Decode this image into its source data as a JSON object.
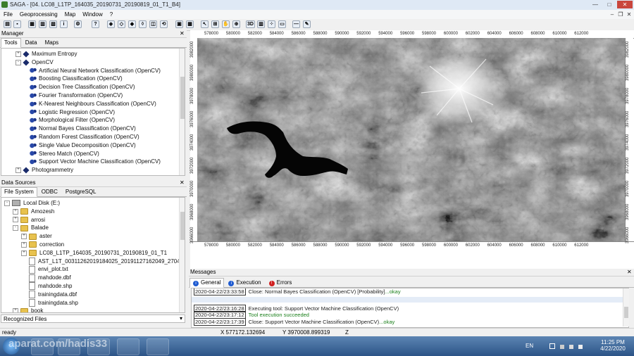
{
  "window": {
    "title": "SAGA - [04. LC08_L1TP_164035_20190731_20190819_01_T1_B4]"
  },
  "menu": [
    "File",
    "Geoprocessing",
    "Map",
    "Window",
    "?"
  ],
  "manager": {
    "title": "Manager",
    "tabs": [
      "Tools",
      "Data",
      "Maps"
    ],
    "tree": [
      {
        "label": "Maximum Entropy",
        "level": 1,
        "kind": "library",
        "exp": "+"
      },
      {
        "label": "OpenCV",
        "level": 1,
        "kind": "library",
        "exp": "-"
      },
      {
        "label": "Artificial Neural Network Classification (OpenCV)",
        "level": 2,
        "kind": "tool"
      },
      {
        "label": "Boosting Classification (OpenCV)",
        "level": 2,
        "kind": "tool"
      },
      {
        "label": "Decision Tree Classification (OpenCV)",
        "level": 2,
        "kind": "tool"
      },
      {
        "label": "Fourier Transformation (OpenCV)",
        "level": 2,
        "kind": "tool"
      },
      {
        "label": "K-Nearest Neighbours Classification (OpenCV)",
        "level": 2,
        "kind": "tool"
      },
      {
        "label": "Logistic Regression (OpenCV)",
        "level": 2,
        "kind": "tool"
      },
      {
        "label": "Morphological Filter (OpenCV)",
        "level": 2,
        "kind": "tool"
      },
      {
        "label": "Normal Bayes Classification (OpenCV)",
        "level": 2,
        "kind": "tool"
      },
      {
        "label": "Random Forest Classification (OpenCV)",
        "level": 2,
        "kind": "tool"
      },
      {
        "label": "Single Value Decomposition (OpenCV)",
        "level": 2,
        "kind": "tool"
      },
      {
        "label": "Stereo Match (OpenCV)",
        "level": 2,
        "kind": "tool"
      },
      {
        "label": "Support Vector Machine Classification (OpenCV)",
        "level": 2,
        "kind": "tool"
      },
      {
        "label": "Photogrammetry",
        "level": 1,
        "kind": "library",
        "exp": "+"
      }
    ]
  },
  "datasources": {
    "title": "Data Sources",
    "tabs": [
      "File System",
      "ODBC",
      "PostgreSQL"
    ],
    "tree": [
      {
        "label": "Local Disk (E:)",
        "level": 0,
        "kind": "disk",
        "exp": "-"
      },
      {
        "label": "Amozesh",
        "level": 1,
        "kind": "folder",
        "exp": "+"
      },
      {
        "label": "arrosi",
        "level": 1,
        "kind": "folder",
        "exp": "+"
      },
      {
        "label": "Balade",
        "level": 1,
        "kind": "folder",
        "exp": "-"
      },
      {
        "label": "aster",
        "level": 2,
        "kind": "folder",
        "exp": "+"
      },
      {
        "label": "correction",
        "level": 2,
        "kind": "folder",
        "exp": "+"
      },
      {
        "label": "LC08_L1TP_164035_20190731_20190819_01_T1",
        "level": 2,
        "kind": "folder",
        "exp": "+"
      },
      {
        "label": "AST_L1T_00311262019184025_20191127162049_27047.hdf",
        "level": 2,
        "kind": "file"
      },
      {
        "label": "envi_plot.txt",
        "level": 2,
        "kind": "file"
      },
      {
        "label": "mahdode.dbf",
        "level": 2,
        "kind": "file"
      },
      {
        "label": "mahdode.shp",
        "level": 2,
        "kind": "file"
      },
      {
        "label": "trainingdata.dbf",
        "level": 2,
        "kind": "file"
      },
      {
        "label": "trainingdata.shp",
        "level": 2,
        "kind": "file"
      },
      {
        "label": "book",
        "level": 1,
        "kind": "folder",
        "exp": "+"
      }
    ],
    "recognized": "Recognized Files"
  },
  "map": {
    "xticks": [
      "578000",
      "580000",
      "582000",
      "584000",
      "586000",
      "588000",
      "590000",
      "592000",
      "594000",
      "596000",
      "598000",
      "600000",
      "602000",
      "604000",
      "606000",
      "608000",
      "610000",
      "612000"
    ],
    "yticks": [
      "3982000",
      "3980000",
      "3978000",
      "3976000",
      "3974000",
      "3972000",
      "3970000",
      "3968000",
      "3966000"
    ]
  },
  "messages": {
    "title": "Messages",
    "tabs": [
      "General",
      "Execution",
      "Errors"
    ],
    "lines": [
      {
        "ts": "2020-04-22/23:33:58",
        "text": "Close: Normal Bayes Classification (OpenCV) [Probability]",
        "ok": "...okay"
      },
      {
        "ts": "2020-04-22/23:16:28",
        "text": "Executing tool: Support Vector Machine Classification (OpenCV)",
        "ok": ""
      },
      {
        "ts": "2020-04-22/23:17:12",
        "text": "Tool execution succeeded",
        "ok": ""
      },
      {
        "ts": "2020-04-22/23:17:39",
        "text": "Close: Support Vector Machine Classification (OpenCV)",
        "ok": "...okay"
      }
    ]
  },
  "status": {
    "ready": "ready",
    "x": "X 577172.132694",
    "y": "Y 3970008.899319",
    "z": "Z"
  },
  "taskbar": {
    "lang": "EN",
    "time": "11:25 PM",
    "date": "4/22/2020",
    "watermark": "aparat.com/hadis33"
  }
}
